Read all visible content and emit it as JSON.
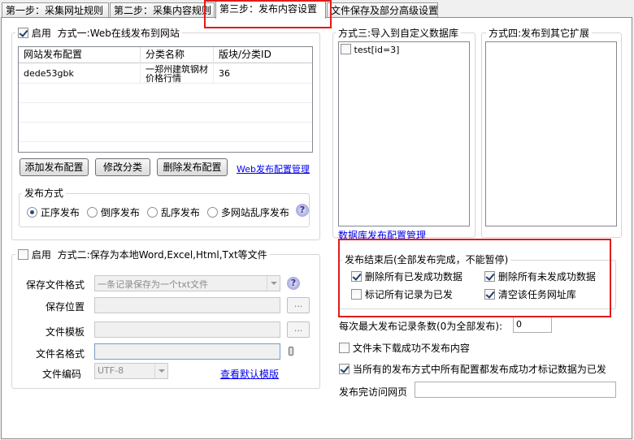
{
  "tabs": [
    {
      "label": "第一步：采集网址规则"
    },
    {
      "label": "第二步：采集内容规则"
    },
    {
      "label": "第三步：发布内容设置"
    },
    {
      "label": "文件保存及部分高级设置"
    }
  ],
  "method1": {
    "enable_label": "启用",
    "title": "方式一:Web在线发布到网站",
    "enabled": true,
    "table": {
      "columns": [
        "网站发布配置",
        "分类名称",
        "版块/分类ID"
      ],
      "rows": [
        {
          "config": "dede53gbk",
          "category": "一郑州建筑钢材价格行情",
          "id": "36"
        }
      ]
    },
    "add_btn": "添加发布配置",
    "edit_btn": "修改分类",
    "delete_btn": "删除发布配置",
    "manage_link": "Web发布配置管理",
    "publish_mode_label": "发布方式",
    "modes": [
      "正序发布",
      "倒序发布",
      "乱序发布",
      "多网站乱序发布"
    ],
    "selected_mode": 0
  },
  "method2": {
    "enable_label": "启用",
    "title": "方式二:保存为本地Word,Excel,Html,Txt等文件",
    "enabled": false,
    "format_label": "保存文件格式",
    "format_value": "一条记录保存为一个txt文件",
    "location_label": "保存位置",
    "template_label": "文件模板",
    "filename_label": "文件名格式",
    "encoding_label": "文件编码",
    "encoding_value": "UTF-8",
    "default_template_link": "查看默认模版",
    "ellipsis": "..."
  },
  "method3": {
    "title": "方式三:导入到自定义数据库",
    "items": [
      {
        "label": "test[id=3]",
        "checked": false
      }
    ],
    "manage_link": "数据库发布配置管理"
  },
  "method4": {
    "title": "方式四:发布到其它扩展"
  },
  "after_publish": {
    "title": "发布结束后(全部发布完成，不能暂停)",
    "options": [
      {
        "label": "删除所有已发成功数据",
        "checked": true
      },
      {
        "label": "删除所有未发成功数据",
        "checked": true
      },
      {
        "label": "标记所有记录为已发",
        "checked": false
      },
      {
        "label": "清空该任务网址库",
        "checked": true
      }
    ]
  },
  "max_records": {
    "label": "每次最大发布记录条数(0为全部发布):",
    "value": "0"
  },
  "skip_failed_download": {
    "label": "文件未下载成功不发布内容",
    "checked": false
  },
  "mark_when_all_success": {
    "label": "当所有的发布方式中所有配置都发布成功才标记数据为已发",
    "checked": true
  },
  "visit_after_publish": {
    "label": "发布完访问网页",
    "value": ""
  },
  "colors": {
    "highlight": "#e01b1b",
    "link": "#0000ee"
  }
}
